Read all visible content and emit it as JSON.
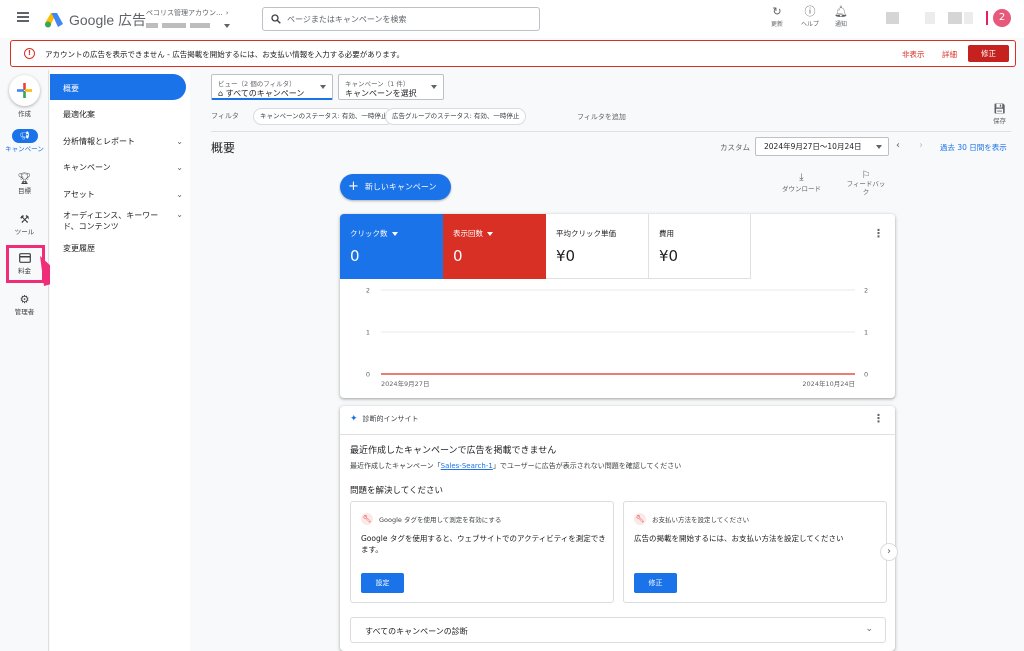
{
  "topbar": {
    "product": "Google 広告",
    "account_name": "ペコリス管理アカウン...",
    "search_placeholder": "ページまたはキャンペーンを検索",
    "actions": [
      {
        "icon": "refresh-icon",
        "label": "更新"
      },
      {
        "icon": "help-icon",
        "label": "ヘルプ"
      },
      {
        "icon": "bell-icon",
        "label": "通知"
      }
    ],
    "avatar_initial": "2"
  },
  "alert": {
    "text": "アカウントの広告を表示できません - 広告掲載を開始するには、お支払い情報を入力する必要があります。",
    "hide": "非表示",
    "detail": "詳細",
    "fix": "修正",
    "accent": "#d93025"
  },
  "rail": {
    "create": "作成",
    "campaign": "キャンペーン",
    "goals": "目標",
    "tools": "ツール",
    "billing": "料金",
    "admin": "管理者"
  },
  "subnav": {
    "items": [
      {
        "label": "概要",
        "active": true
      },
      {
        "label": "最適化案"
      },
      {
        "label": "分析情報とレポート",
        "chevron": true
      },
      {
        "label": "キャンペーン",
        "chevron": true
      },
      {
        "label": "アセット",
        "chevron": true
      },
      {
        "label": "オーディエンス、キーワード、コンテンツ",
        "chevron": true
      },
      {
        "label": "変更履歴"
      }
    ]
  },
  "selectors": {
    "view_label": "ビュー（2 個のフィルタ）",
    "view_value": "すべてのキャンペーン",
    "campaign_label": "キャンペーン（1 件）",
    "campaign_value": "キャンペーンを選択"
  },
  "filters": {
    "label": "フィルタ",
    "chips": [
      "キャンペーンのステータス: 有効、一時停止",
      "広告グループのステータス: 有効、一時停止"
    ],
    "add": "フィルタを追加",
    "save": "保存"
  },
  "header": {
    "title": "概要",
    "custom": "カスタム",
    "date_range": "2024年9月27日〜10月24日",
    "last30": "過去 30 日間を表示"
  },
  "actions": {
    "new_campaign": "新しいキャンペーン",
    "download": "ダウンロード",
    "feedback": "フィードバック"
  },
  "metrics": [
    {
      "label": "クリック数",
      "value": "0",
      "color": "#1a73e8",
      "dropdown": true
    },
    {
      "label": "表示回数",
      "value": "0",
      "color": "#d93025",
      "dropdown": true
    },
    {
      "label": "平均クリック単価",
      "value": "¥0"
    },
    {
      "label": "費用",
      "value": "¥0"
    }
  ],
  "chart_data": {
    "type": "line",
    "x": [
      "2024年9月27日",
      "2024年10月24日"
    ],
    "series": [
      {
        "values": [
          0,
          0
        ],
        "color": "#d93025"
      }
    ],
    "y_ticks_left": [
      0,
      1,
      2
    ],
    "y_ticks_right": [
      0,
      1,
      2
    ],
    "ylim": [
      0,
      2
    ],
    "grid": true
  },
  "insights": {
    "title": "診断的インサイト",
    "headline": "最近作成したキャンペーンで広告を掲載できません",
    "desc_prefix": "最近作成したキャンペーン「",
    "desc_link": "Sales-Search-1",
    "desc_suffix": "」でユーザーに広告が表示されない問題を確認してください",
    "resolve": "問題を解決してください",
    "cards": [
      {
        "title": "Google タグを使用して測定を有効にする",
        "body": "Google タグを使用すると、ウェブサイトでのアクティビティを測定できます。",
        "button": "設定"
      },
      {
        "title": "お支払い方法を設定してください",
        "body": "広告の掲載を開始するには、お支払い方法を設定してください",
        "button": "修正"
      }
    ],
    "all_diag": "すべてのキャンペーンの診断"
  }
}
